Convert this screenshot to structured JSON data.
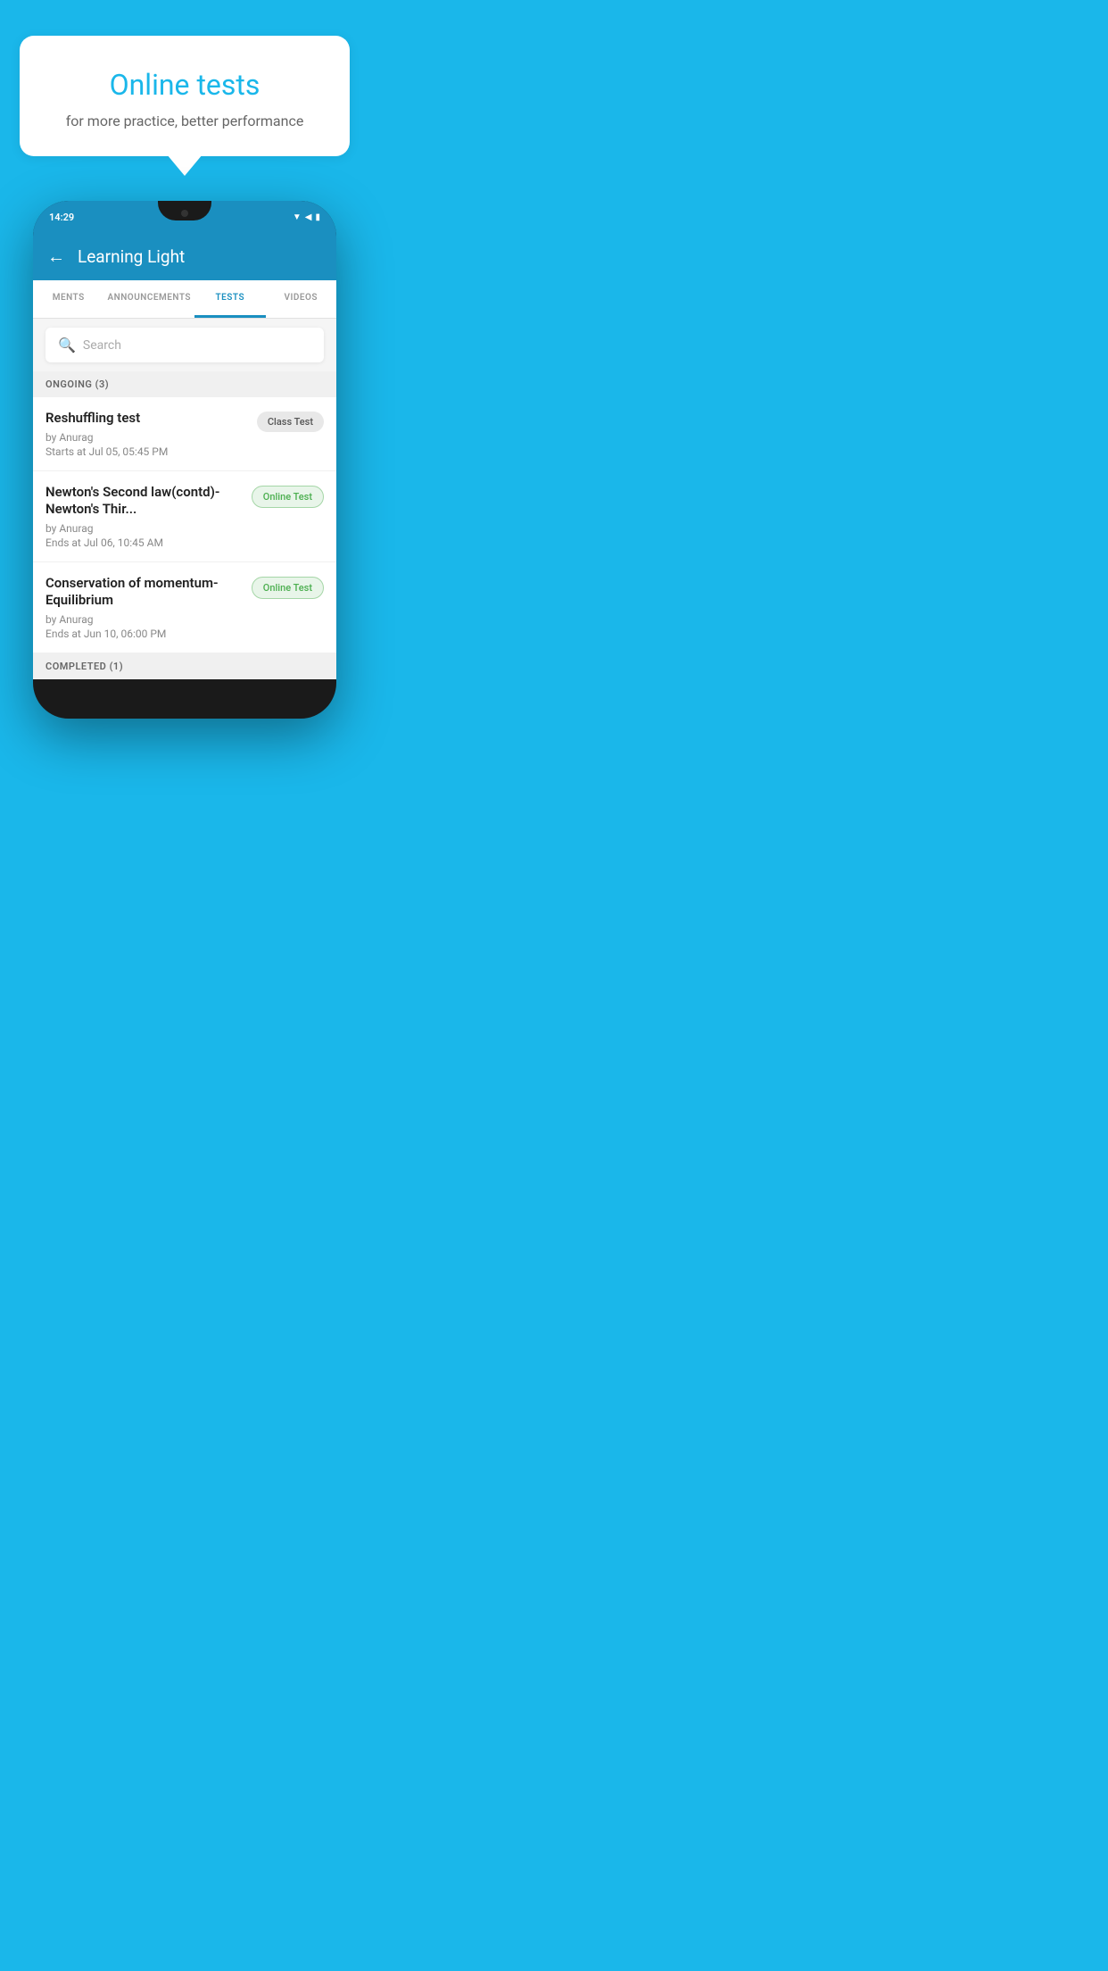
{
  "background_color": "#1ab7ea",
  "speech_bubble": {
    "title": "Online tests",
    "subtitle": "for more practice, better performance"
  },
  "phone": {
    "status_bar": {
      "time": "14:29",
      "icons": [
        "wifi",
        "signal",
        "battery"
      ]
    },
    "header": {
      "title": "Learning Light",
      "back_label": "←"
    },
    "tabs": [
      {
        "label": "MENTS",
        "active": false
      },
      {
        "label": "ANNOUNCEMENTS",
        "active": false
      },
      {
        "label": "TESTS",
        "active": true
      },
      {
        "label": "VIDEOS",
        "active": false
      }
    ],
    "search": {
      "placeholder": "Search"
    },
    "ongoing_section": {
      "label": "ONGOING (3)"
    },
    "test_items": [
      {
        "name": "Reshuffling test",
        "author": "by Anurag",
        "date": "Starts at  Jul 05, 05:45 PM",
        "badge": "Class Test",
        "badge_type": "class"
      },
      {
        "name": "Newton's Second law(contd)-Newton's Thir...",
        "author": "by Anurag",
        "date": "Ends at  Jul 06, 10:45 AM",
        "badge": "Online Test",
        "badge_type": "online"
      },
      {
        "name": "Conservation of momentum-Equilibrium",
        "author": "by Anurag",
        "date": "Ends at  Jun 10, 06:00 PM",
        "badge": "Online Test",
        "badge_type": "online"
      }
    ],
    "completed_section": {
      "label": "COMPLETED (1)"
    }
  }
}
